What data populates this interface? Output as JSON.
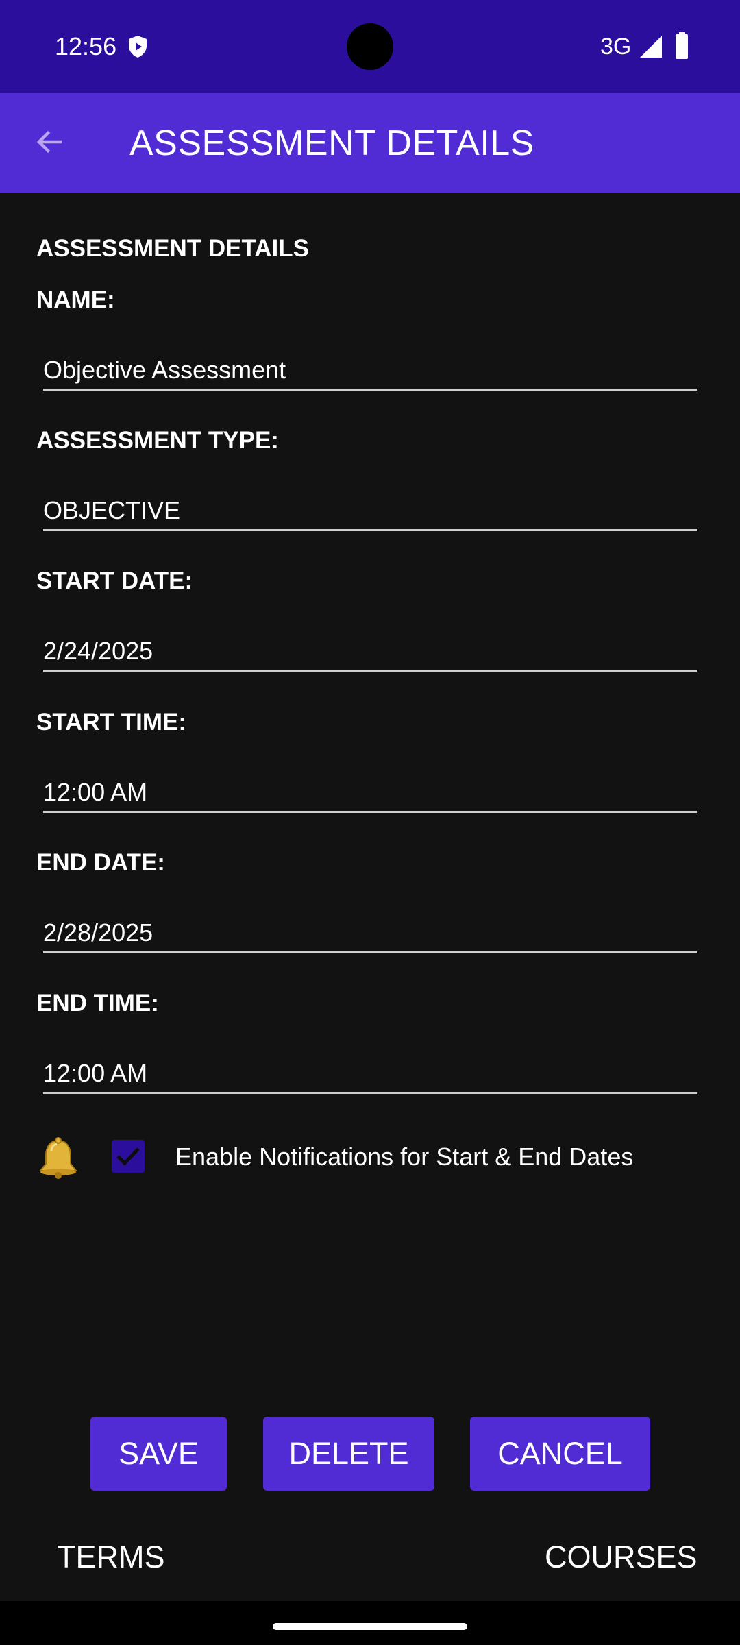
{
  "status_bar": {
    "time": "12:56",
    "network": "3G",
    "icons": [
      "shield-icon",
      "signal-icon",
      "battery-icon"
    ]
  },
  "app_bar": {
    "title": "ASSESSMENT DETAILS",
    "back_icon": "arrow-back-icon"
  },
  "form": {
    "section_title": "ASSESSMENT DETAILS",
    "name_label": "NAME:",
    "name_value": "Objective Assessment",
    "type_label": "ASSESSMENT TYPE:",
    "type_value": "OBJECTIVE",
    "start_date_label": "START DATE:",
    "start_date_value": "2/24/2025",
    "start_time_label": "START TIME:",
    "start_time_value": "12:00 AM",
    "end_date_label": "END DATE:",
    "end_date_value": "2/28/2025",
    "end_time_label": "END TIME:",
    "end_time_value": "12:00 AM"
  },
  "notifications": {
    "icon": "bell-icon",
    "checked": true,
    "label": "Enable Notifications for Start & End Dates"
  },
  "buttons": {
    "save": "SAVE",
    "delete": "DELETE",
    "cancel": "CANCEL"
  },
  "footer": {
    "terms": "TERMS",
    "courses": "COURSES"
  },
  "colors": {
    "status_bar": "#2c0e9c",
    "app_bar": "#512bd4",
    "background": "#121212",
    "button": "#512bd4"
  }
}
